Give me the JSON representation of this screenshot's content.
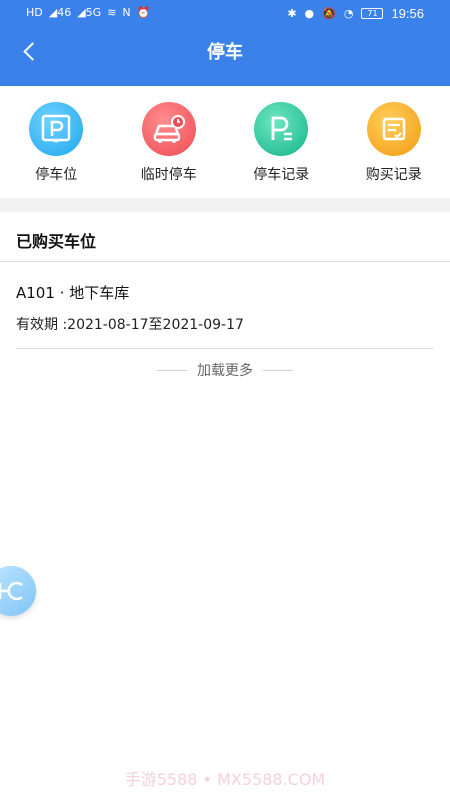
{
  "status_bar": {
    "left_glyphs": [
      "HD",
      "46",
      "5G",
      "wifi",
      "NFC",
      "alarm"
    ],
    "battery": "71",
    "time": "19:56"
  },
  "header": {
    "title": "停车"
  },
  "quick_actions": [
    {
      "label": "停车位",
      "icon": "parking-space-icon",
      "color": "#2fb3f2"
    },
    {
      "label": "临时停车",
      "icon": "temporary-parking-car-icon",
      "color": "#f15b60"
    },
    {
      "label": "停车记录",
      "icon": "parking-record-icon",
      "color": "#22c39a"
    },
    {
      "label": "购买记录",
      "icon": "purchase-record-icon",
      "color": "#f6a623"
    }
  ],
  "section": {
    "title": "已购买车位"
  },
  "items": [
    {
      "title": "A101 · 地下车库",
      "validity_label": "有效期 :",
      "validity_range": "2021-08-17至2021-09-17"
    }
  ],
  "load_more": "加载更多",
  "watermark": "手游5588 • MX5588.COM",
  "colors": {
    "primary": "#3a82ea"
  }
}
